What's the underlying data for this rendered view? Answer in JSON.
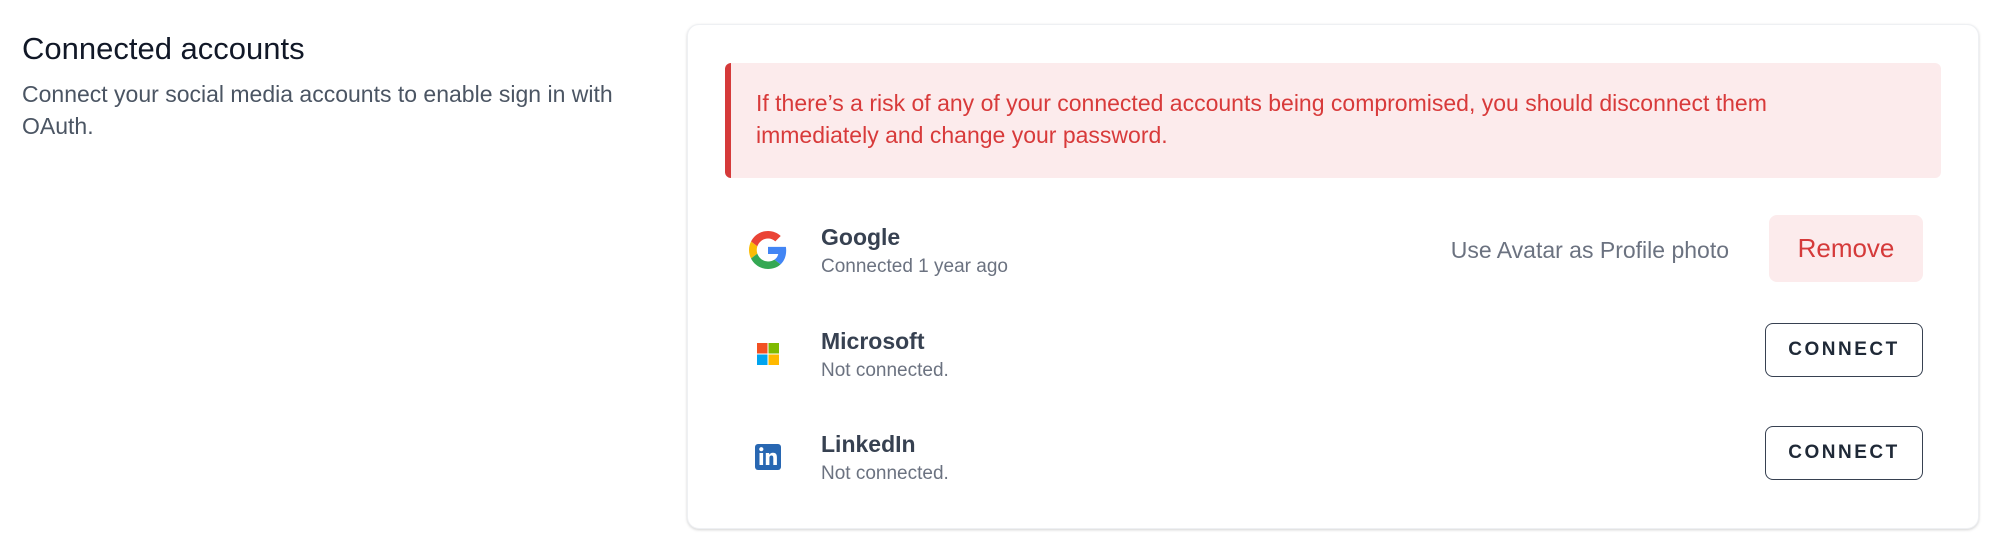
{
  "section": {
    "title": "Connected accounts",
    "description": "Connect your social media accounts to enable sign in with OAuth."
  },
  "alert": {
    "text": "If there’s a risk of any of your connected accounts being compromised, you should disconnect them immediately and change your password."
  },
  "accounts": [
    {
      "provider": "Google",
      "status": "Connected 1 year ago",
      "icon": "google-icon",
      "connected": true,
      "avatar_action": "Use Avatar as Profile photo",
      "action_label": "Remove"
    },
    {
      "provider": "Microsoft",
      "status": "Not connected.",
      "icon": "microsoft-icon",
      "connected": false,
      "action_label": "CONNECT"
    },
    {
      "provider": "LinkedIn",
      "status": "Not connected.",
      "icon": "linkedin-icon",
      "connected": false,
      "action_label": "CONNECT"
    }
  ],
  "colors": {
    "danger": "#d53a3a",
    "danger_bg": "#fcebec",
    "text_muted": "#6b7280",
    "linkedin_blue": "#2867b2"
  }
}
